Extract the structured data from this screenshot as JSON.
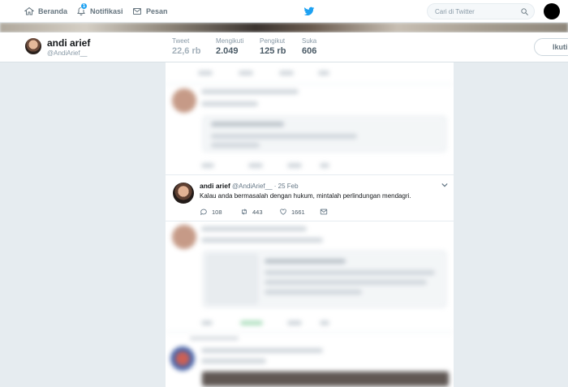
{
  "nav": {
    "home_label": "Beranda",
    "notifications_label": "Notifikasi",
    "notifications_badge": "1",
    "messages_label": "Pesan",
    "search_placeholder": "Cari di Twitter"
  },
  "profile": {
    "name": "andi arief",
    "handle": "@AndiArief__",
    "stats": [
      {
        "label": "Tweet",
        "value": "22,6 rb"
      },
      {
        "label": "Mengikuti",
        "value": "2.049"
      },
      {
        "label": "Pengikut",
        "value": "125 rb"
      },
      {
        "label": "Suka",
        "value": "606"
      }
    ],
    "follow_label": "Ikuti"
  },
  "tweet": {
    "name": "andi arief",
    "handle": "@AndiArief__",
    "separator": "·",
    "date": "25 Feb",
    "text": "Kalau anda bermasalah dengan hukum, mintalah perlindungan mendagri.",
    "replies": "108",
    "retweets": "443",
    "likes": "1661"
  },
  "colors": {
    "brand": "#1da1f2",
    "background": "#e6ecf0",
    "muted": "#8899a6"
  }
}
